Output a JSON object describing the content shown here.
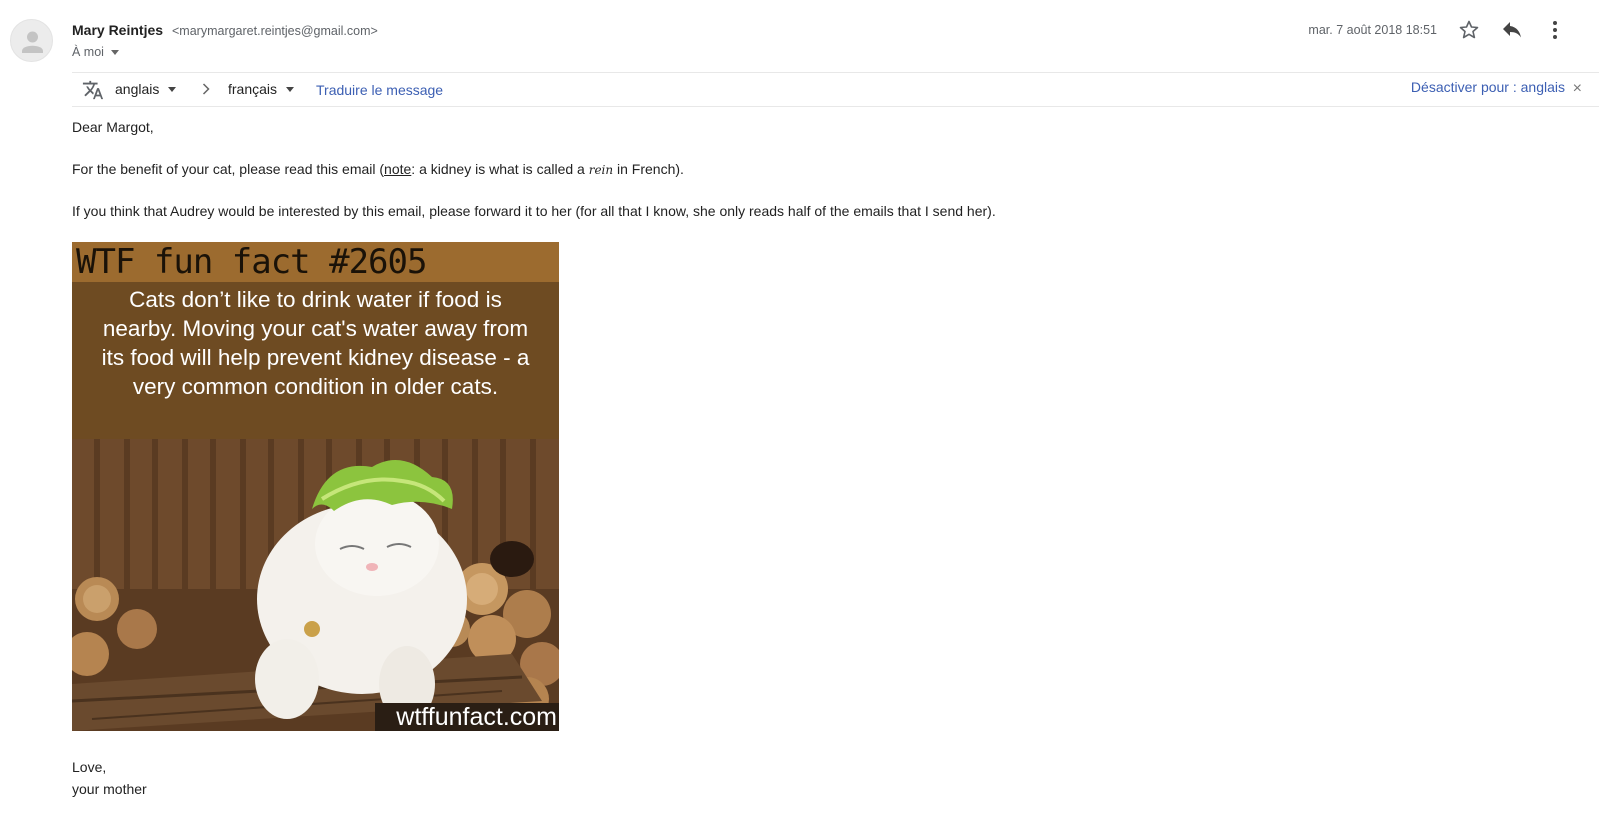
{
  "header": {
    "sender_name": "Mary Reintjes",
    "sender_email": "<marymargaret.reintjes@gmail.com>",
    "to": "À moi",
    "date": "mar. 7 août 2018 18:51",
    "icons": {
      "star": "star-icon",
      "reply": "reply-icon",
      "more": "more-vert-icon"
    }
  },
  "translate": {
    "source_lang": "anglais",
    "target_lang": "français",
    "translate_link": "Traduire le message",
    "disable_label": "Désactiver pour : anglais",
    "close_symbol": "×"
  },
  "body": {
    "greeting": "Dear Margot,",
    "p1_before": "For the benefit of your cat, please read this email (",
    "p1_note": "note",
    "p1_middle": ": a kidney is what is called a ",
    "p1_italic": "rein",
    "p1_after": " in French).",
    "p2": "If you think that Audrey would be interested by this email, please forward it to her (for all that I know, she only reads half of the emails that I send her).",
    "signoff": "Love,",
    "signature": "your mother"
  },
  "image": {
    "header": "WTF fun fact #2605",
    "caption_lines": [
      "Cats don’t like to drink water if food is",
      "nearby. Moving your cat's water away from",
      "its food will help prevent kidney disease - a",
      "very common condition in older cats."
    ],
    "watermark": "wtffunfact.com"
  }
}
